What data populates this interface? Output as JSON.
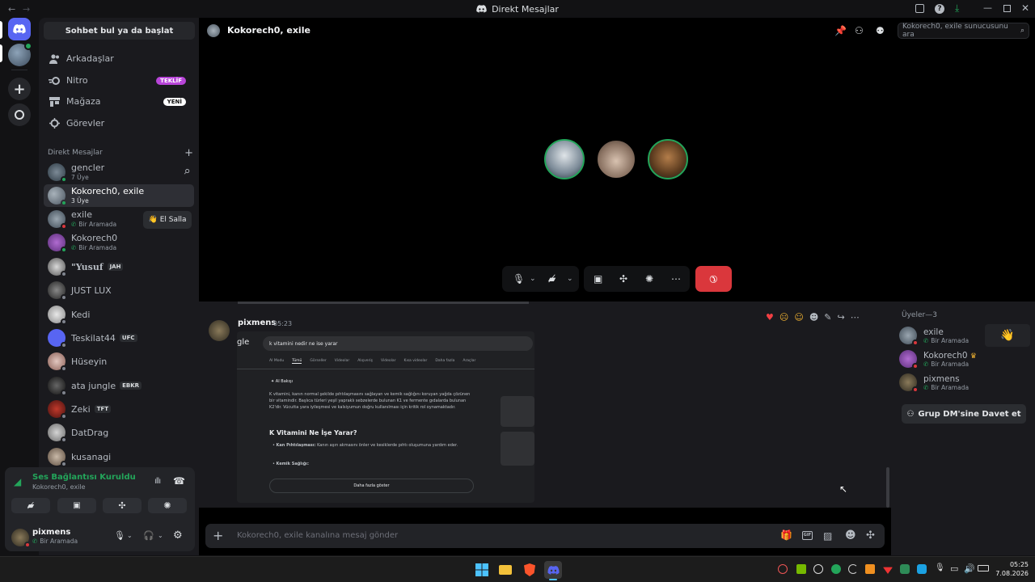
{
  "window": {
    "title": "Direkt Mesajlar"
  },
  "sidebar": {
    "search_label": "Sohbet bul ya da başlat",
    "nav": [
      {
        "label": "Arkadaşlar",
        "icon": "friends-icon"
      },
      {
        "label": "Nitro",
        "icon": "nitro-icon",
        "badge": "TEKLİF",
        "badge_color": "#b845d9"
      },
      {
        "label": "Mağaza",
        "icon": "shop-icon",
        "badge": "YENİ",
        "badge_color": "#ffffff"
      },
      {
        "label": "Görevler",
        "icon": "quests-icon"
      }
    ],
    "dm_header": "Direkt Mesajlar",
    "dms": [
      {
        "name": "gencler",
        "sub": "7 Üye"
      },
      {
        "name": "Kokorech0, exile",
        "sub": "3 Üye"
      },
      {
        "name": "exile",
        "sub": "Bir Aramada"
      },
      {
        "name": "Kokorech0",
        "sub": "Bir Aramada"
      },
      {
        "name": "\"Yusuf",
        "tag": "JAH"
      },
      {
        "name": "JUST LUX"
      },
      {
        "name": "Kedi"
      },
      {
        "name": "Teskilat44",
        "tag": "UFC"
      },
      {
        "name": "Hüseyin"
      },
      {
        "name": "ata jungle",
        "tag": "EBKR"
      },
      {
        "name": "Zeki",
        "tag": "TFT"
      },
      {
        "name": "DatDrag"
      },
      {
        "name": "kusanagi"
      }
    ],
    "wave_label": "El Salla"
  },
  "voice": {
    "status": "Ses Bağlantısı Kuruldu",
    "channel": "Kokorech0, exile"
  },
  "user": {
    "name": "pixmens",
    "status": "Bir Aramada"
  },
  "channel": {
    "title": "Kokorech0, exile",
    "search_placeholder": "Kokorech0, exile sunucusunu ara"
  },
  "message": {
    "author": "pixmens",
    "time": "05:23",
    "reactions": [
      "heart",
      "face-raised-eyebrow",
      "wink"
    ]
  },
  "screenshot_content": {
    "logo_fragment": "gle",
    "query": "k vitamini nedir ne ise yarar",
    "tabs": [
      "AI Modu",
      "Tümü",
      "Görseller",
      "Videolar",
      "Alışveriş",
      "Videolar",
      "Kısa videolar",
      "Daha fazla",
      "Araçlar"
    ],
    "ai_label": "AI Bakışı",
    "para1": "K vitamini, kanın normal şekilde pıhtılaşmasını sağlayan ve kemik sağlığını koruyan yağda çözünen bir vitamindir. Başlıca türleri yeşil yapraklı sebzelerde bulunan K1 ve fermente gıdalarda bulunan K2'dir. Vücutta yara iyileşmesi ve kalsiyumun doğru kullanılması için kritik rol oynamaktadır.",
    "heading": "K Vitamini Ne İşe Yarar?",
    "bullet1_title": "Kan Pıhtılaşması:",
    "bullet1": "Kanın aşırı akmasını önler ve kesiklerde pıhtı oluşumuna yardım eder.",
    "bullet2_title": "Kemik Sağlığı:",
    "more": "Daha fazla göster"
  },
  "composer": {
    "placeholder": "Kokorech0, exile kanalına mesaj gönder"
  },
  "members": {
    "header": "Üyeler—3",
    "list": [
      {
        "name": "exile",
        "sub": "Bir Aramada"
      },
      {
        "name": "Kokorech0",
        "sub": "Bir Aramada"
      },
      {
        "name": "pixmens",
        "sub": "Bir Aramada"
      }
    ],
    "invite_label": "Grup DM'sine Davet et"
  },
  "taskbar": {
    "time": "05:25",
    "date": "7.08.2026"
  },
  "colors": {
    "accent": "#5865f2",
    "online": "#23a55a",
    "danger": "#da373c"
  }
}
